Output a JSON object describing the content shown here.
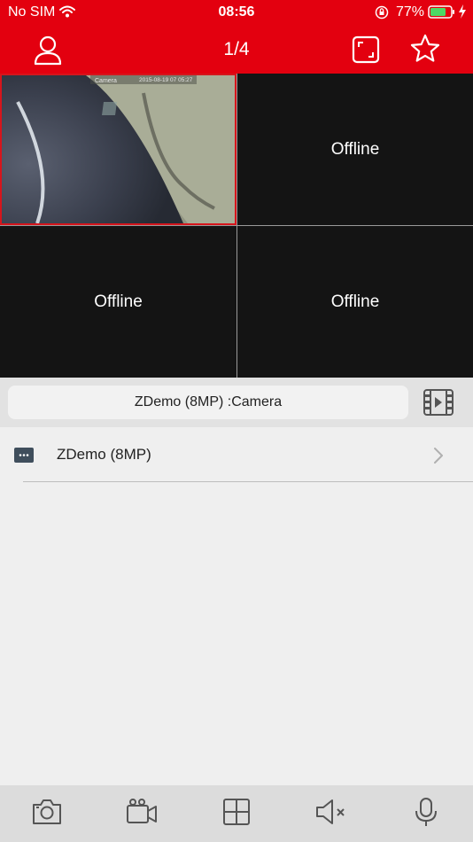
{
  "status": {
    "carrier": "No SIM",
    "time": "08:56",
    "battery_pct": "77%"
  },
  "nav": {
    "page_indicator": "1/4"
  },
  "grid": {
    "tiles": [
      {
        "name": "live-feed",
        "overlay_label": "Camera",
        "overlay_timestamp": "2015-08-19 07 05:27"
      },
      {
        "status": "Offline"
      },
      {
        "status": "Offline"
      },
      {
        "status": "Offline"
      }
    ]
  },
  "camera_bar": {
    "selected_camera": "ZDemo (8MP) :Camera"
  },
  "device_list": [
    {
      "label": "ZDemo (8MP)"
    }
  ],
  "colors": {
    "brand_red": "#e3000f",
    "tile_bg": "#141414",
    "selected_border": "#d6151c"
  },
  "icons": {
    "user": "person-outline-icon",
    "fullscreen": "fullscreen-frame-icon",
    "favorite": "star-outline-icon",
    "playback": "film-play-icon",
    "device": "dvr-device-icon",
    "snapshot": "camera-icon",
    "record": "video-camera-icon",
    "layout": "grid-layout-icon",
    "mute": "speaker-mute-icon",
    "talk": "microphone-icon"
  }
}
